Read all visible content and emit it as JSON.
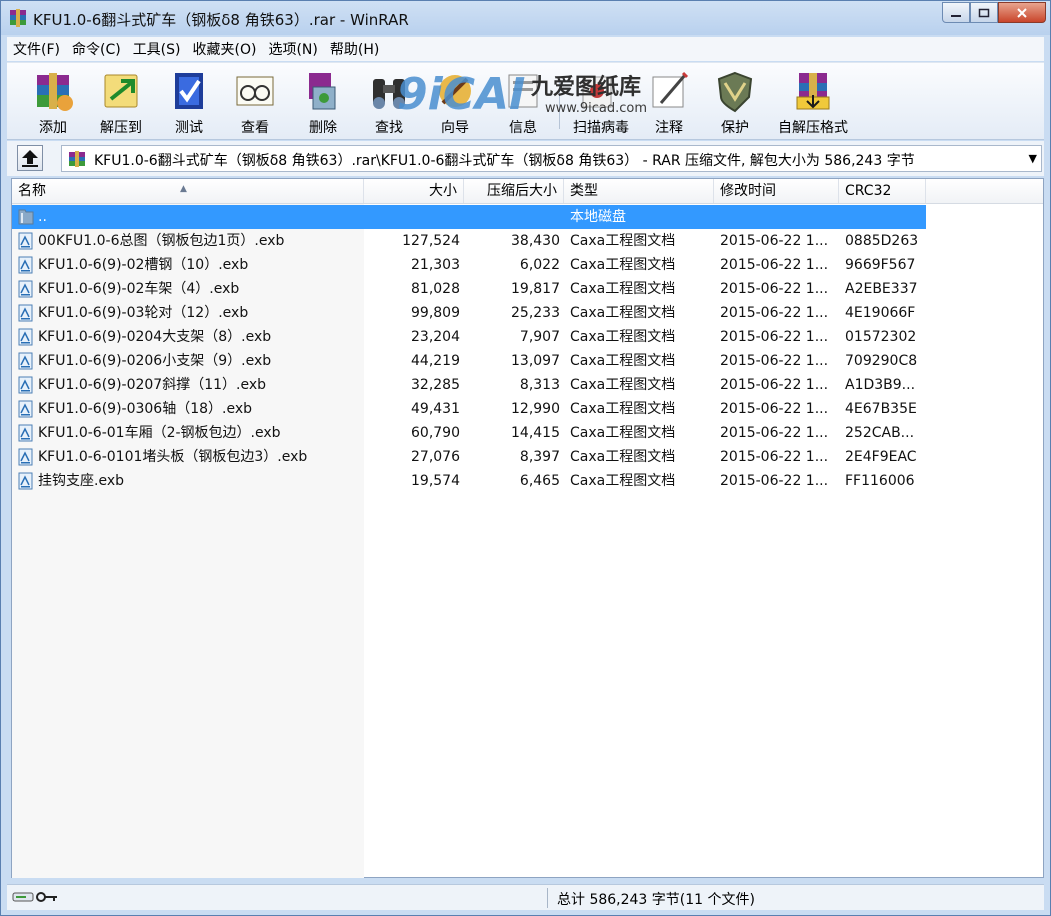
{
  "window": {
    "title": "KFU1.0-6翻斗式矿车（钢板δ8 角铁63）.rar - WinRAR",
    "buttons": [
      "minimize",
      "maximize",
      "close"
    ]
  },
  "menubar": [
    "文件(F)",
    "命令(C)",
    "工具(S)",
    "收藏夹(O)",
    "选项(N)",
    "帮助(H)"
  ],
  "toolbar": [
    {
      "label": "添加",
      "icon": "add-archive-icon"
    },
    {
      "label": "解压到",
      "icon": "extract-to-icon"
    },
    {
      "label": "测试",
      "icon": "test-icon"
    },
    {
      "label": "查看",
      "icon": "view-icon"
    },
    {
      "label": "删除",
      "icon": "delete-icon"
    },
    {
      "label": "查找",
      "icon": "find-icon"
    },
    {
      "label": "向导",
      "icon": "wizard-icon"
    },
    {
      "label": "信息",
      "icon": "info-icon"
    },
    {
      "label": "扫描病毒",
      "icon": "virus-scan-icon"
    },
    {
      "label": "注释",
      "icon": "comment-icon"
    },
    {
      "label": "保护",
      "icon": "protect-icon"
    },
    {
      "label": "自解压格式",
      "icon": "sfx-icon"
    }
  ],
  "watermark": {
    "text_cn": "九爱图纸库",
    "url": "www.9icad.com"
  },
  "address": {
    "path": "KFU1.0-6翻斗式矿车（钢板δ8 角铁63）.rar\\KFU1.0-6翻斗式矿车（钢板δ8 角铁63） - RAR 压缩文件, 解包大小为 586,243 字节"
  },
  "columns": {
    "name": "名称",
    "size": "大小",
    "packed": "压缩后大小",
    "type": "类型",
    "modified": "修改时间",
    "crc": "CRC32"
  },
  "files": [
    {
      "name": "..",
      "size": "",
      "packed": "",
      "type": "本地磁盘",
      "modified": "",
      "crc": "",
      "icon": "folder-up-icon",
      "selected": true
    },
    {
      "name": "00KFU1.0-6总图（钢板包边1页）.exb",
      "size": "127,524",
      "packed": "38,430",
      "type": "Caxa工程图文档",
      "modified": "2015-06-22 1...",
      "crc": "0885D263",
      "icon": "caxa-file-icon"
    },
    {
      "name": "KFU1.0-6(9)-02槽钢（10）.exb",
      "size": "21,303",
      "packed": "6,022",
      "type": "Caxa工程图文档",
      "modified": "2015-06-22 1...",
      "crc": "9669F567",
      "icon": "caxa-file-icon"
    },
    {
      "name": "KFU1.0-6(9)-02车架（4）.exb",
      "size": "81,028",
      "packed": "19,817",
      "type": "Caxa工程图文档",
      "modified": "2015-06-22 1...",
      "crc": "A2EBE337",
      "icon": "caxa-file-icon"
    },
    {
      "name": "KFU1.0-6(9)-03轮对（12）.exb",
      "size": "99,809",
      "packed": "25,233",
      "type": "Caxa工程图文档",
      "modified": "2015-06-22 1...",
      "crc": "4E19066F",
      "icon": "caxa-file-icon"
    },
    {
      "name": "KFU1.0-6(9)-0204大支架（8）.exb",
      "size": "23,204",
      "packed": "7,907",
      "type": "Caxa工程图文档",
      "modified": "2015-06-22 1...",
      "crc": "01572302",
      "icon": "caxa-file-icon"
    },
    {
      "name": "KFU1.0-6(9)-0206小支架（9）.exb",
      "size": "44,219",
      "packed": "13,097",
      "type": "Caxa工程图文档",
      "modified": "2015-06-22 1...",
      "crc": "709290C8",
      "icon": "caxa-file-icon"
    },
    {
      "name": "KFU1.0-6(9)-0207斜撑（11）.exb",
      "size": "32,285",
      "packed": "8,313",
      "type": "Caxa工程图文档",
      "modified": "2015-06-22 1...",
      "crc": "A1D3B9...",
      "icon": "caxa-file-icon"
    },
    {
      "name": "KFU1.0-6(9)-0306轴（18）.exb",
      "size": "49,431",
      "packed": "12,990",
      "type": "Caxa工程图文档",
      "modified": "2015-06-22 1...",
      "crc": "4E67B35E",
      "icon": "caxa-file-icon"
    },
    {
      "name": "KFU1.0-6-01车厢（2-钢板包边）.exb",
      "size": "60,790",
      "packed": "14,415",
      "type": "Caxa工程图文档",
      "modified": "2015-06-22 1...",
      "crc": "252CAB...",
      "icon": "caxa-file-icon"
    },
    {
      "name": "KFU1.0-6-0101堵头板（钢板包边3）.exb",
      "size": "27,076",
      "packed": "8,397",
      "type": "Caxa工程图文档",
      "modified": "2015-06-22 1...",
      "crc": "2E4F9EAC",
      "icon": "caxa-file-icon"
    },
    {
      "name": "挂钩支座.exb",
      "size": "19,574",
      "packed": "6,465",
      "type": "Caxa工程图文档",
      "modified": "2015-06-22 1...",
      "crc": "FF116006",
      "icon": "caxa-file-icon"
    }
  ],
  "status": {
    "summary": "总计 586,243 字节(11 个文件)"
  },
  "colors": {
    "selection": "#3399ff",
    "titlebar": "#c9dcf2",
    "close_button": "#c9452b"
  }
}
